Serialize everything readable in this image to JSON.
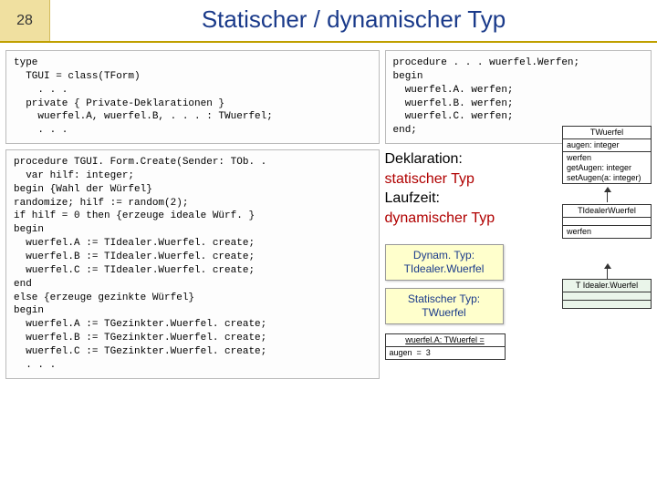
{
  "page_number": "28",
  "title": "Statischer / dynamischer Typ",
  "code_type": "type\n  TGUI = class(TForm)\n    . . .\n  private { Private-Deklarationen }\n    wuerfel.A, wuerfel.B, . . . : TWuerfel;\n    . . .",
  "code_formcreate": "procedure TGUI. Form.Create(Sender: TOb. .\n  var hilf: integer;\nbegin {Wahl der Würfel}\nrandomize; hilf := random(2);\nif hilf = 0 then {erzeuge ideale Würf. }\nbegin\n  wuerfel.A := TIdealer.Wuerfel. create;\n  wuerfel.B := TIdealer.Wuerfel. create;\n  wuerfel.C := TIdealer.Wuerfel. create;\nend\nelse {erzeuge gezinkte Würfel}\nbegin\n  wuerfel.A := TGezinkter.Wuerfel. create;\n  wuerfel.B := TGezinkter.Wuerfel. create;\n  wuerfel.C := TGezinkter.Wuerfel. create;\n  . . .",
  "code_werfen": "procedure . . . wuerfel.Werfen;\nbegin\n  wuerfel.A. werfen;\n  wuerfel.B. werfen;\n  wuerfel.C. werfen;\nend;",
  "explain": {
    "l1a": "Deklaration:",
    "l1b": "statischer Typ",
    "l2a": "Laufzeit:",
    "l2b": "dynamischer Typ"
  },
  "callout_dyn": "Dynam. Typ:\nTIdealer.Wuerfel",
  "callout_stat": "Statischer Typ:\nTWuerfel",
  "uml": {
    "twuerfel": {
      "name": "TWuerfel",
      "attrs": "augen: integer",
      "ops": "werfen\ngetAugen: integer\nsetAugen(a: integer)"
    },
    "tidealer": {
      "name": "TIdealerWuerfel",
      "attrs": "",
      "ops": "werfen"
    },
    "tidealer2": {
      "name": "T Idealer.Wuerfel"
    },
    "obj": {
      "name": "wuerfel.A: TWuerfel =",
      "attrs": "augen  =  3"
    }
  }
}
